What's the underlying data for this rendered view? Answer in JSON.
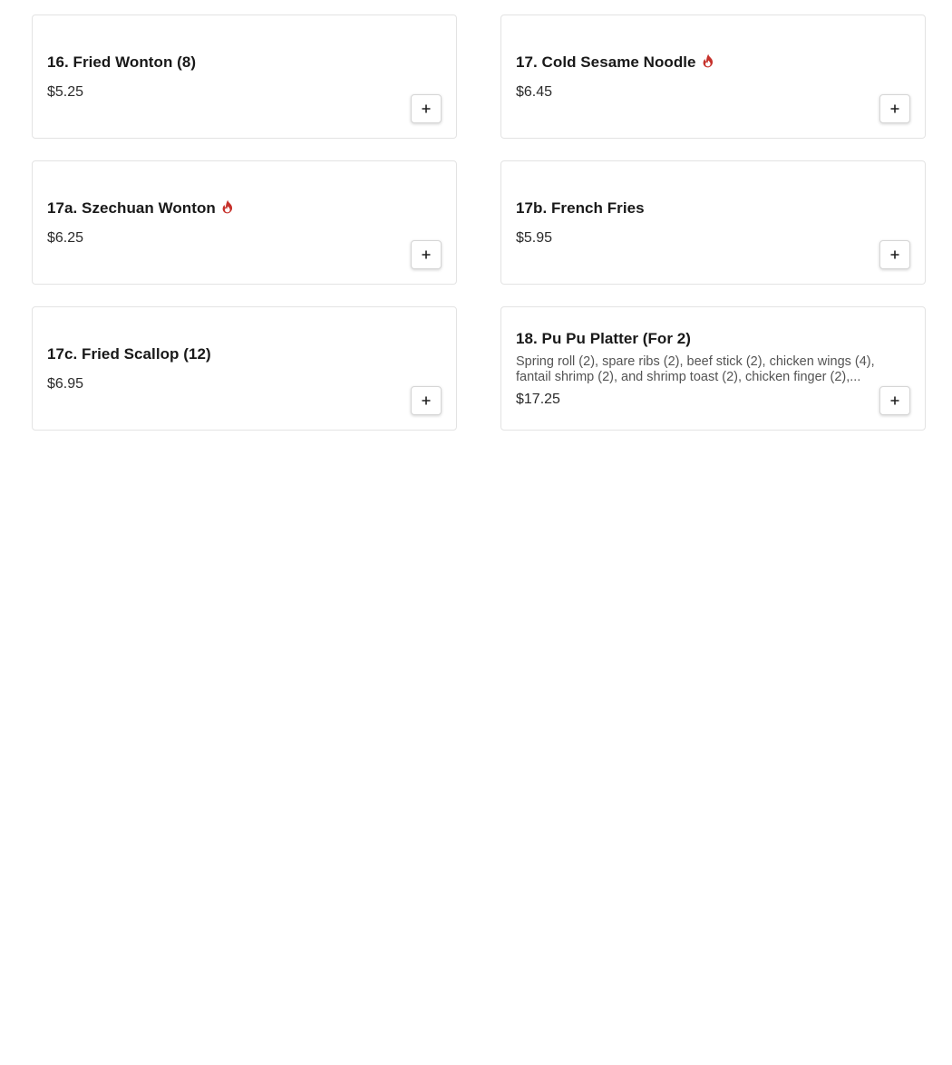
{
  "menu": {
    "items": [
      {
        "title": "16. Fried Wonton (8)",
        "price": "$5.25",
        "spicy": false,
        "description": "",
        "add_icon": "plus-icon"
      },
      {
        "title": "17. Cold Sesame Noodle",
        "price": "$6.45",
        "spicy": true,
        "description": "",
        "add_icon": "plus-icon"
      },
      {
        "title": "17a. Szechuan Wonton",
        "price": "$6.25",
        "spicy": true,
        "description": "",
        "add_icon": "plus-icon"
      },
      {
        "title": "17b. French Fries",
        "price": "$5.95",
        "spicy": false,
        "description": "",
        "add_icon": "plus-icon"
      },
      {
        "title": "17c. Fried Scallop (12)",
        "price": "$6.95",
        "spicy": false,
        "description": "",
        "add_icon": "plus-icon"
      },
      {
        "title": "18. Pu Pu Platter (For 2)",
        "price": "$17.25",
        "spicy": false,
        "description": "Spring roll (2), spare ribs (2), beef stick (2), chicken wings (4), fantail shrimp (2), and shrimp toast (2), chicken finger (2),...",
        "add_icon": "plus-icon"
      }
    ]
  },
  "colors": {
    "spicy": "#c6312b",
    "border": "#e3e3e3",
    "text": "#191919"
  }
}
